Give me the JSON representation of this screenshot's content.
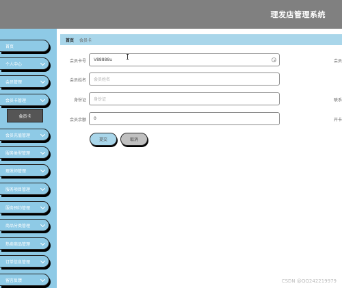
{
  "header": {
    "title": "理发店管理系统"
  },
  "sidebar": {
    "items": [
      {
        "label": "首页",
        "has_chevron": false
      },
      {
        "label": "个人中心",
        "has_chevron": true
      },
      {
        "label": "会员管理",
        "has_chevron": true
      },
      {
        "label": "会员卡管理",
        "has_chevron": true
      },
      {
        "label": "会员充值管理",
        "has_chevron": true
      },
      {
        "label": "服务类型管理",
        "has_chevron": true
      },
      {
        "label": "理发师管理",
        "has_chevron": true
      },
      {
        "label": "服务项目管理",
        "has_chevron": true
      },
      {
        "label": "服务预约管理",
        "has_chevron": true
      },
      {
        "label": "商品分类管理",
        "has_chevron": true
      },
      {
        "label": "热卖商品管理",
        "has_chevron": true
      },
      {
        "label": "订单信息管理",
        "has_chevron": true
      },
      {
        "label": "留言反馈",
        "has_chevron": true
      }
    ],
    "sub_item": {
      "label": "会员卡"
    }
  },
  "breadcrumb": {
    "home": "首页",
    "current": "会员卡"
  },
  "form": {
    "card_no": {
      "label": "会员卡号",
      "value": "V88888u"
    },
    "member_name": {
      "label": "会员姓名",
      "placeholder": "会员姓名"
    },
    "id_card": {
      "label": "身份证",
      "placeholder": "身份证"
    },
    "balance": {
      "label": "会员余额",
      "value": "0"
    },
    "right_labels": [
      "会员",
      "联系",
      "开卡"
    ]
  },
  "buttons": {
    "submit": "提交",
    "cancel": "取消"
  },
  "watermark": "CSDN @QQ242219979"
}
